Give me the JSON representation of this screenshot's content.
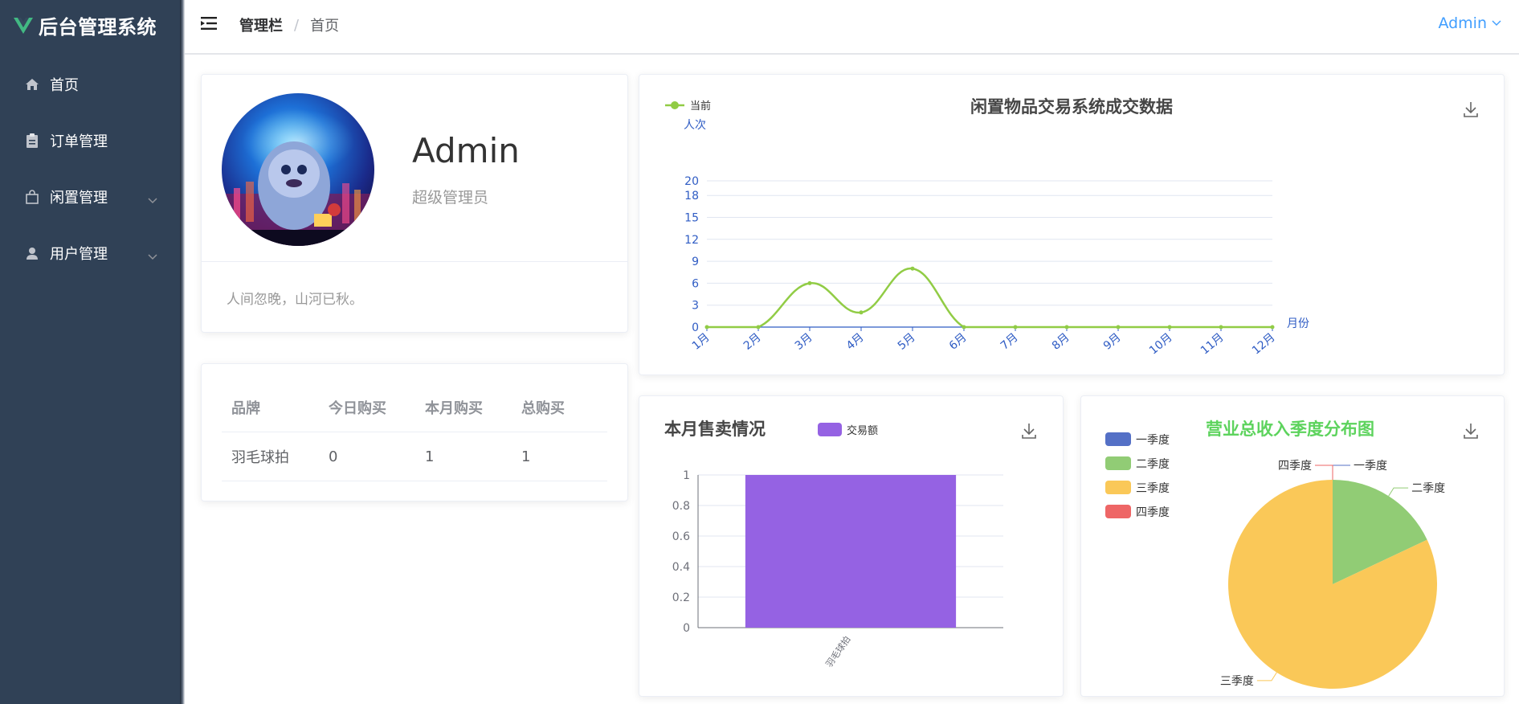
{
  "app": {
    "title": "后台管理系统"
  },
  "sidebar": {
    "items": [
      {
        "label": "首页",
        "icon": "home-icon"
      },
      {
        "label": "订单管理",
        "icon": "clipboard-icon"
      },
      {
        "label": "闲置管理",
        "icon": "bag-icon",
        "expandable": true
      },
      {
        "label": "用户管理",
        "icon": "user-icon",
        "expandable": true
      }
    ]
  },
  "header": {
    "breadcrumb": [
      "管理栏",
      "首页"
    ],
    "separator": "/",
    "user": "Admin"
  },
  "profile": {
    "name": "Admin",
    "role": "超级管理员",
    "motto": "人间忽晚，山河已秋。"
  },
  "purchase_table": {
    "headers": [
      "品牌",
      "今日购买",
      "本月购买",
      "总购买"
    ],
    "rows": [
      [
        "羽毛球拍",
        "0",
        "1",
        "1"
      ]
    ]
  },
  "colors": {
    "sidebar_bg": "#304156",
    "accent": "#409eff",
    "logo_v": "#42b983",
    "line": "#91cc45",
    "bar": "#9562e3",
    "pie_q1": "#5470c6",
    "pie_q2": "#91cc75",
    "pie_q3": "#fac858",
    "pie_q4": "#ee6666",
    "pie_title": "#5dd35d"
  },
  "chart_data": [
    {
      "type": "line",
      "title": "闲置物品交易系统成交数据",
      "legend": "当前",
      "ylabel": "人次",
      "xlabel": "月份",
      "categories": [
        "1月",
        "2月",
        "3月",
        "4月",
        "5月",
        "6月",
        "7月",
        "8月",
        "9月",
        "10月",
        "11月",
        "12月"
      ],
      "series": [
        {
          "name": "当前",
          "values": [
            0,
            0,
            6,
            2,
            8,
            0,
            0,
            0,
            0,
            0,
            0,
            0
          ]
        }
      ],
      "yticks": [
        0,
        3,
        6,
        9,
        12,
        15,
        18,
        20
      ],
      "ylim": [
        0,
        20
      ],
      "smooth": true
    },
    {
      "type": "bar",
      "title": "本月售卖情况",
      "legend": "交易额",
      "categories": [
        "羽毛球拍"
      ],
      "series": [
        {
          "name": "交易额",
          "values": [
            1
          ]
        }
      ],
      "yticks": [
        "0",
        "0.2",
        "0.4",
        "0.6",
        "0.8",
        "1"
      ],
      "ylim": [
        0,
        1
      ]
    },
    {
      "type": "pie",
      "title": "营业总收入季度分布图",
      "legend_position": "left",
      "slices": [
        {
          "name": "一季度",
          "value": 0
        },
        {
          "name": "二季度",
          "value": 18
        },
        {
          "name": "三季度",
          "value": 82
        },
        {
          "name": "四季度",
          "value": 0
        }
      ]
    }
  ]
}
